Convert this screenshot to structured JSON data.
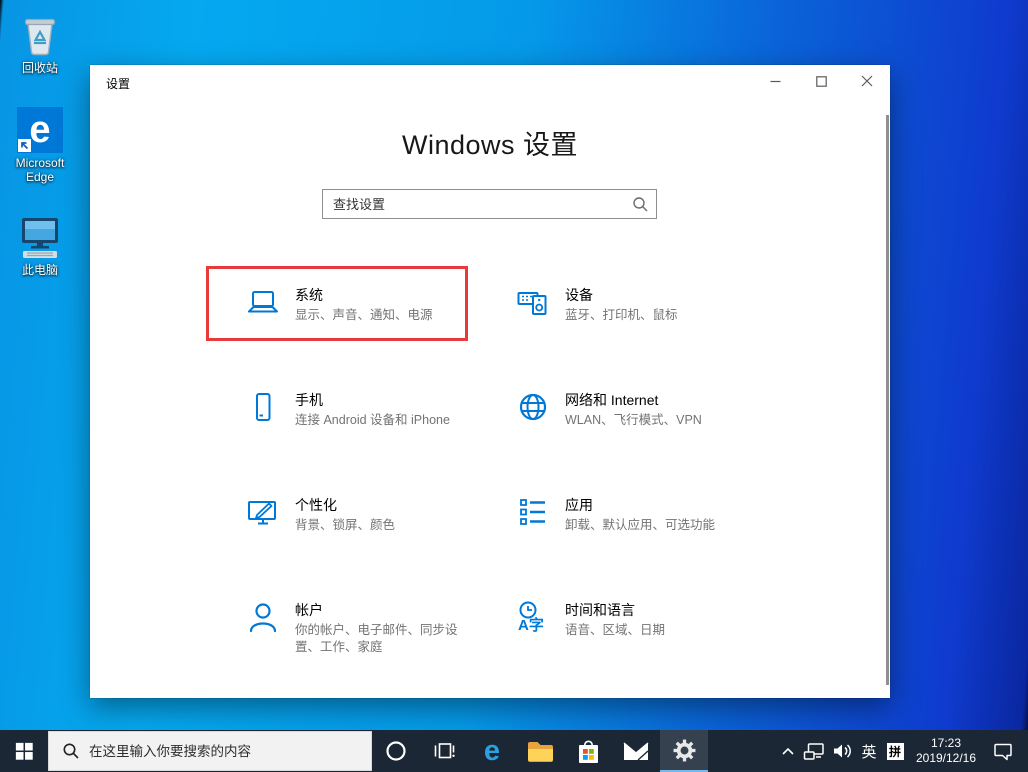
{
  "colors": {
    "accent_blue": "#0078d7",
    "highlight_red": "#e8393b",
    "taskbar_bg": "#1b2734",
    "desktop_left_blue": "#05a9f0",
    "desktop_right_blue": "#0f3bce"
  },
  "desktop": {
    "edge_glyph": "e",
    "icons": [
      {
        "label": "回收站"
      },
      {
        "label": "Microsoft Edge"
      },
      {
        "label": "此电脑"
      }
    ]
  },
  "settings_window": {
    "title": "设置",
    "heading": "Windows 设置",
    "search": {
      "placeholder": "查找设置"
    },
    "tiles": [
      {
        "title": "系统",
        "subtitle": "显示、声音、通知、电源",
        "icon": "laptop-icon",
        "highlighted": true
      },
      {
        "title": "设备",
        "subtitle": "蓝牙、打印机、鼠标",
        "icon": "devices-icon",
        "highlighted": false
      },
      {
        "title": "手机",
        "subtitle": "连接 Android 设备和 iPhone",
        "icon": "phone-icon",
        "highlighted": false
      },
      {
        "title": "网络和 Internet",
        "subtitle": "WLAN、飞行模式、VPN",
        "icon": "globe-icon",
        "highlighted": false
      },
      {
        "title": "个性化",
        "subtitle": "背景、锁屏、颜色",
        "icon": "personalization-icon",
        "highlighted": false
      },
      {
        "title": "应用",
        "subtitle": "卸载、默认应用、可选功能",
        "icon": "apps-list-icon",
        "highlighted": false
      },
      {
        "title": "帐户",
        "subtitle": "你的帐户、电子邮件、同步设置、工作、家庭",
        "icon": "account-icon",
        "highlighted": false
      },
      {
        "title": "时间和语言",
        "subtitle": "语音、区域、日期",
        "icon": "time-language-icon",
        "icon_text": "A字",
        "highlighted": false
      }
    ]
  },
  "taskbar": {
    "search": {
      "placeholder": "在这里输入你要搜索的内容"
    },
    "edge_glyph": "e",
    "tray": {
      "language_indicator": "英",
      "ime_indicator": "拼",
      "time": "17:23",
      "date": "2019/12/16"
    }
  }
}
